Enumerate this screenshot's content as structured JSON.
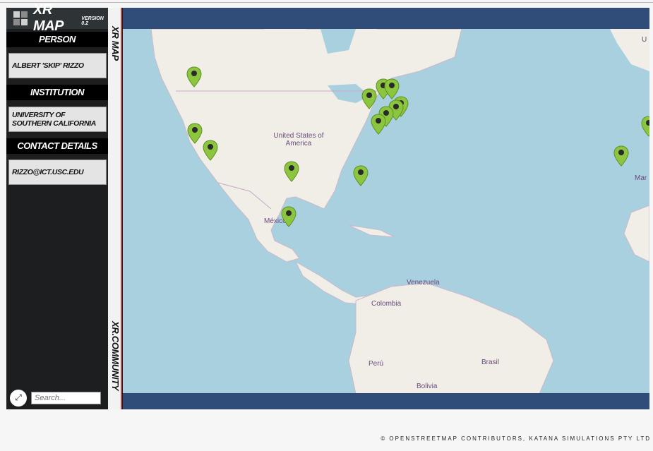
{
  "app": {
    "title": "XR MAP",
    "version": "VERSION 0.2"
  },
  "sidebar": {
    "person_heading": "PERSON",
    "person_value": "ALBERT 'SKIP' RIZZO",
    "institution_heading": "INSTITUTION",
    "institution_value": "UNIVERSITY OF SOUTHERN CALIFORNIA",
    "contact_heading": "CONTACT DETAILS",
    "contact_value": "RIZZO@ICT.USC.EDU",
    "search_placeholder": "Search..."
  },
  "vertical": {
    "top": "XR MAP",
    "bottom": "XR.COMMUNITY"
  },
  "map": {
    "labels": {
      "usa": "United States of America",
      "mexico": "México",
      "venezuela": "Venezuela",
      "colombia": "Colombia",
      "peru": "Perú",
      "brasil": "Brasil",
      "bolivia": "Bolivia",
      "mar": "Mar",
      "u": "U"
    },
    "pin_color": "#8cc63f"
  },
  "footer": "© OPENSTREETMAP CONTRIBUTORS, KATANA SIMULATIONS PTY LTD",
  "icons": {
    "logo": "logo-grid-icon",
    "expand": "expand-icon",
    "pin": "map-pin-icon"
  }
}
